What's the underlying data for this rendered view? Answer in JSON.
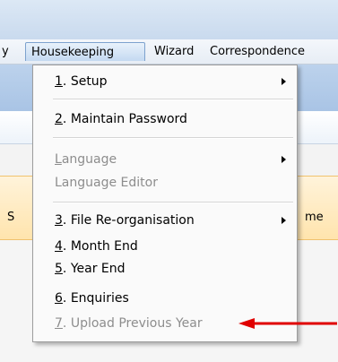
{
  "menubar": {
    "items": [
      {
        "label": "y"
      },
      {
        "label": "Housekeeping"
      },
      {
        "label": "Wizard"
      },
      {
        "label": "Correspondence"
      }
    ]
  },
  "background": {
    "left_fragment": "S",
    "right_fragment": "me"
  },
  "dropdown": {
    "items": [
      {
        "key": "1",
        "label": ". Setup",
        "disabled": false,
        "submenu": true
      },
      {
        "key": "2",
        "label": ". Maintain Password",
        "disabled": false,
        "submenu": false
      },
      {
        "key": "L",
        "label": "anguage",
        "disabled": true,
        "submenu": true
      },
      {
        "key": "",
        "label": "Language Editor",
        "disabled": true,
        "submenu": false
      },
      {
        "key": "3",
        "label": ". File Re-organisation",
        "disabled": false,
        "submenu": true
      },
      {
        "key": "4",
        "label": ". Month End",
        "disabled": false,
        "submenu": false
      },
      {
        "key": "5",
        "label": ". Year End",
        "disabled": false,
        "submenu": false
      },
      {
        "key": "6",
        "label": ". Enquiries",
        "disabled": false,
        "submenu": false
      },
      {
        "key": "7",
        "label": ". Upload Previous Year",
        "disabled": true,
        "submenu": false
      }
    ]
  },
  "annotation": {
    "arrow_color": "#e00000"
  }
}
